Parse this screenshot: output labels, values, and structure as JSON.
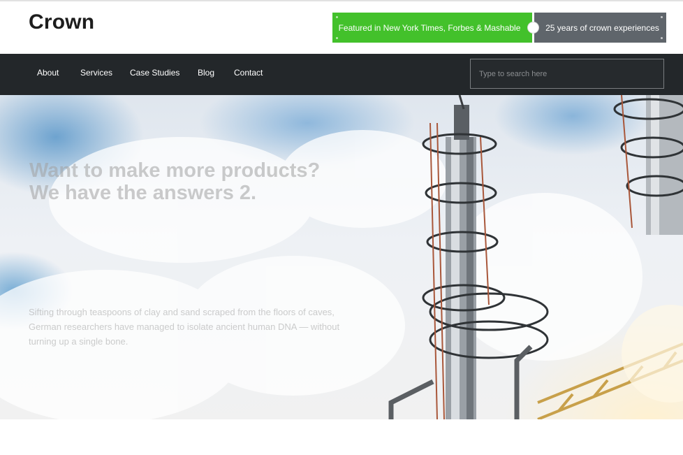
{
  "brand": {
    "logo_text": "Crown"
  },
  "header": {
    "badge_featured": "Featured in New York Times, Forbes & Mashable",
    "badge_years": "25 years of crown experiences",
    "colors": {
      "featured_bg": "#43c12b",
      "years_bg": "#5f656b"
    }
  },
  "nav": {
    "items": [
      {
        "label": "About"
      },
      {
        "label": "Services"
      },
      {
        "label": "Case Studies"
      },
      {
        "label": "Blog"
      },
      {
        "label": "Contact"
      }
    ],
    "search": {
      "placeholder": "Type to search here",
      "value": ""
    },
    "bg_color": "#23272a"
  },
  "hero": {
    "title_line1": "Want to make more products?",
    "title_line2": "We have the answers 2.",
    "description": "Sifting through teaspoons of clay and sand scraped from the floors of caves, German researchers have managed to isolate ancient human DNA — without turning up a single bone.",
    "image": "industrial-refinery-tower-sky"
  }
}
